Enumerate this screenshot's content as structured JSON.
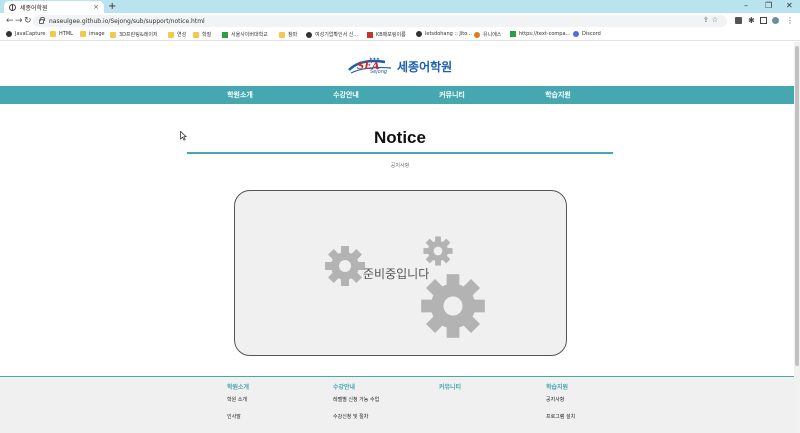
{
  "browser": {
    "tab_title": "세종어학원",
    "tab_close": "×",
    "new_tab": "+",
    "url": "naseulgee.github.io/Sejong/sub/support/notice.html",
    "window_minimize": "–",
    "window_restore": "❐",
    "window_close": "✕",
    "bookmarks": [
      {
        "label": "JavaCapture",
        "icon": "globe-icon"
      },
      {
        "label": "HTML",
        "icon": "folder-icon"
      },
      {
        "label": "image",
        "icon": "folder-icon"
      },
      {
        "label": "3D프린팅&레이저",
        "icon": "folder-icon"
      },
      {
        "label": "연성",
        "icon": "folder-icon"
      },
      {
        "label": "학질",
        "icon": "folder-icon"
      },
      {
        "label": "서울사이버대학교",
        "icon": "green-icon"
      },
      {
        "label": "참파",
        "icon": "folder-icon"
      },
      {
        "label": "여성기업확인서 신...",
        "icon": "globe-icon"
      },
      {
        "label": "KB매포링이름",
        "icon": "red-icon"
      },
      {
        "label": "letsdohang :: Jito...",
        "icon": "globe-icon"
      },
      {
        "label": "유니에스",
        "icon": "orange-icon"
      },
      {
        "label": "https://text-compa...",
        "icon": "green-icon"
      },
      {
        "label": "Discord",
        "icon": "blue-icon"
      }
    ]
  },
  "site": {
    "logo_sea": "SEA",
    "logo_sejong": "Sejong",
    "logo_korean": "세종어학원",
    "nav": [
      "학원소개",
      "수강안내",
      "커뮤니티",
      "학습지원"
    ]
  },
  "content": {
    "heading": "Notice",
    "subheading": "공지사항",
    "placeholder_text": "준비중입니다"
  },
  "footer": {
    "columns": [
      {
        "title": "학원소개",
        "links": [
          "학원 소개",
          "인사말"
        ]
      },
      {
        "title": "수강안내",
        "links": [
          "레벨별 신청 가능 수업",
          "수강신청 및 절차"
        ]
      },
      {
        "title": "커뮤니티",
        "links": []
      },
      {
        "title": "학습지원",
        "links": [
          "공지사항",
          "프로그램 설치"
        ]
      }
    ]
  },
  "colors": {
    "accent": "#45a7af",
    "tabstrip": "#b9e3ee",
    "logo_blue": "#1b5fb0",
    "logo_red": "#c42b2b"
  }
}
